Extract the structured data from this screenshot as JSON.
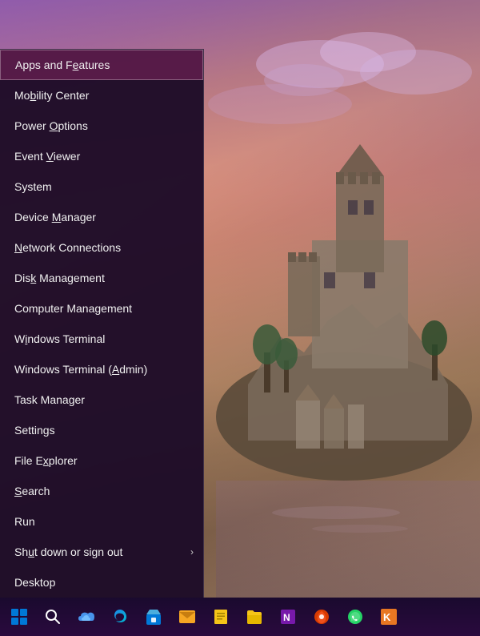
{
  "wallpaper": {
    "description": "Mont Saint-Michel castle at sunset with purple-pink sky"
  },
  "contextMenu": {
    "items": [
      {
        "id": "apps-features",
        "label": "Apps and Features",
        "underline": "F",
        "selected": true,
        "hasArrow": false
      },
      {
        "id": "mobility-center",
        "label": "Mobility Center",
        "underline": "b",
        "selected": false,
        "hasArrow": false
      },
      {
        "id": "power-options",
        "label": "Power Options",
        "underline": "O",
        "selected": false,
        "hasArrow": false
      },
      {
        "id": "event-viewer",
        "label": "Event Viewer",
        "underline": "V",
        "selected": false,
        "hasArrow": false
      },
      {
        "id": "system",
        "label": "System",
        "underline": "",
        "selected": false,
        "hasArrow": false
      },
      {
        "id": "device-manager",
        "label": "Device Manager",
        "underline": "M",
        "selected": false,
        "hasArrow": false
      },
      {
        "id": "network-connections",
        "label": "Network Connections",
        "underline": "N",
        "selected": false,
        "hasArrow": false
      },
      {
        "id": "disk-management",
        "label": "Disk Management",
        "underline": "k",
        "selected": false,
        "hasArrow": false
      },
      {
        "id": "computer-management",
        "label": "Computer Management",
        "underline": "",
        "selected": false,
        "hasArrow": false
      },
      {
        "id": "windows-terminal",
        "label": "Windows Terminal",
        "underline": "i",
        "selected": false,
        "hasArrow": false
      },
      {
        "id": "windows-terminal-admin",
        "label": "Windows Terminal (Admin)",
        "underline": "A",
        "selected": false,
        "hasArrow": false
      },
      {
        "id": "task-manager",
        "label": "Task Manager",
        "underline": "",
        "selected": false,
        "hasArrow": false
      },
      {
        "id": "settings",
        "label": "Settings",
        "underline": "",
        "selected": false,
        "hasArrow": false
      },
      {
        "id": "file-explorer",
        "label": "File Explorer",
        "underline": "x",
        "selected": false,
        "hasArrow": false
      },
      {
        "id": "search",
        "label": "Search",
        "underline": "S",
        "selected": false,
        "hasArrow": false
      },
      {
        "id": "run",
        "label": "Run",
        "underline": "",
        "selected": false,
        "hasArrow": false
      },
      {
        "id": "shut-down",
        "label": "Shut down or sign out",
        "underline": "u",
        "selected": false,
        "hasArrow": true
      },
      {
        "id": "desktop",
        "label": "Desktop",
        "underline": "",
        "selected": false,
        "hasArrow": false
      }
    ]
  },
  "taskbar": {
    "icons": [
      {
        "id": "start",
        "name": "windows-start-icon",
        "color": "#0078d7"
      },
      {
        "id": "search",
        "name": "search-taskbar-icon",
        "color": "#ffffff"
      },
      {
        "id": "onedrive",
        "name": "onedrive-icon",
        "color": "#0078d7"
      },
      {
        "id": "edge",
        "name": "edge-icon",
        "color": "#0078d7"
      },
      {
        "id": "store",
        "name": "store-icon",
        "color": "#0078d7"
      },
      {
        "id": "mail",
        "name": "mail-icon",
        "color": "#f5c518"
      },
      {
        "id": "notepad",
        "name": "notepad-icon",
        "color": "#f5c518"
      },
      {
        "id": "explorer",
        "name": "explorer-icon",
        "color": "#0078d7"
      },
      {
        "id": "onenote",
        "name": "onenote-icon",
        "color": "#7719aa"
      },
      {
        "id": "office",
        "name": "office-icon",
        "color": "#d83b01"
      },
      {
        "id": "whatsapp",
        "name": "whatsapp-icon",
        "color": "#25d366"
      },
      {
        "id": "karate",
        "name": "karate-icon",
        "color": "#e87722"
      }
    ]
  }
}
